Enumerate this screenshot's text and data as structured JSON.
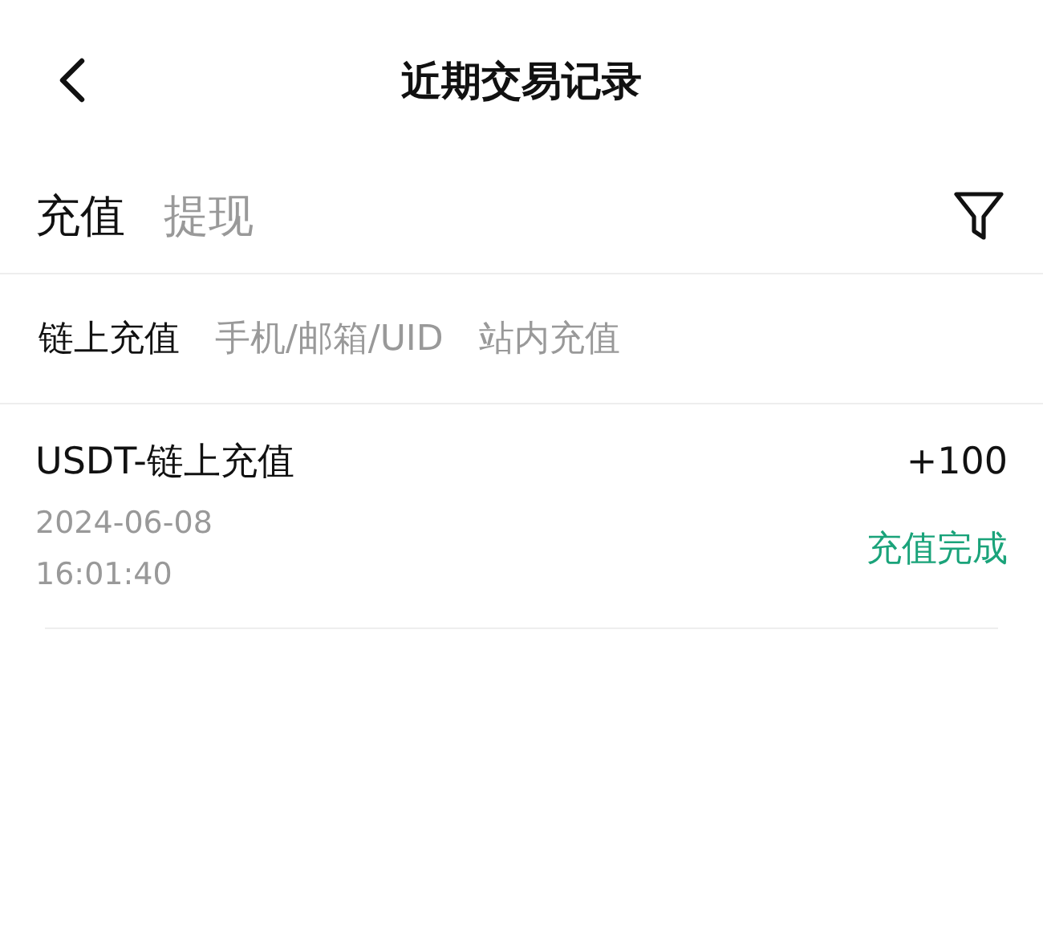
{
  "header": {
    "title": "近期交易记录"
  },
  "tabs": [
    {
      "label": "充值",
      "selected": true
    },
    {
      "label": "提现",
      "selected": false
    }
  ],
  "subtabs": [
    {
      "label": "链上充值",
      "selected": true
    },
    {
      "label": "手机/邮箱/UID",
      "selected": false
    },
    {
      "label": "站内充值",
      "selected": false
    }
  ],
  "records": [
    {
      "title": "USDT-链上充值",
      "amount": "+100",
      "date": "2024-06-08",
      "time": "16:01:40",
      "status": "充值完成"
    }
  ]
}
